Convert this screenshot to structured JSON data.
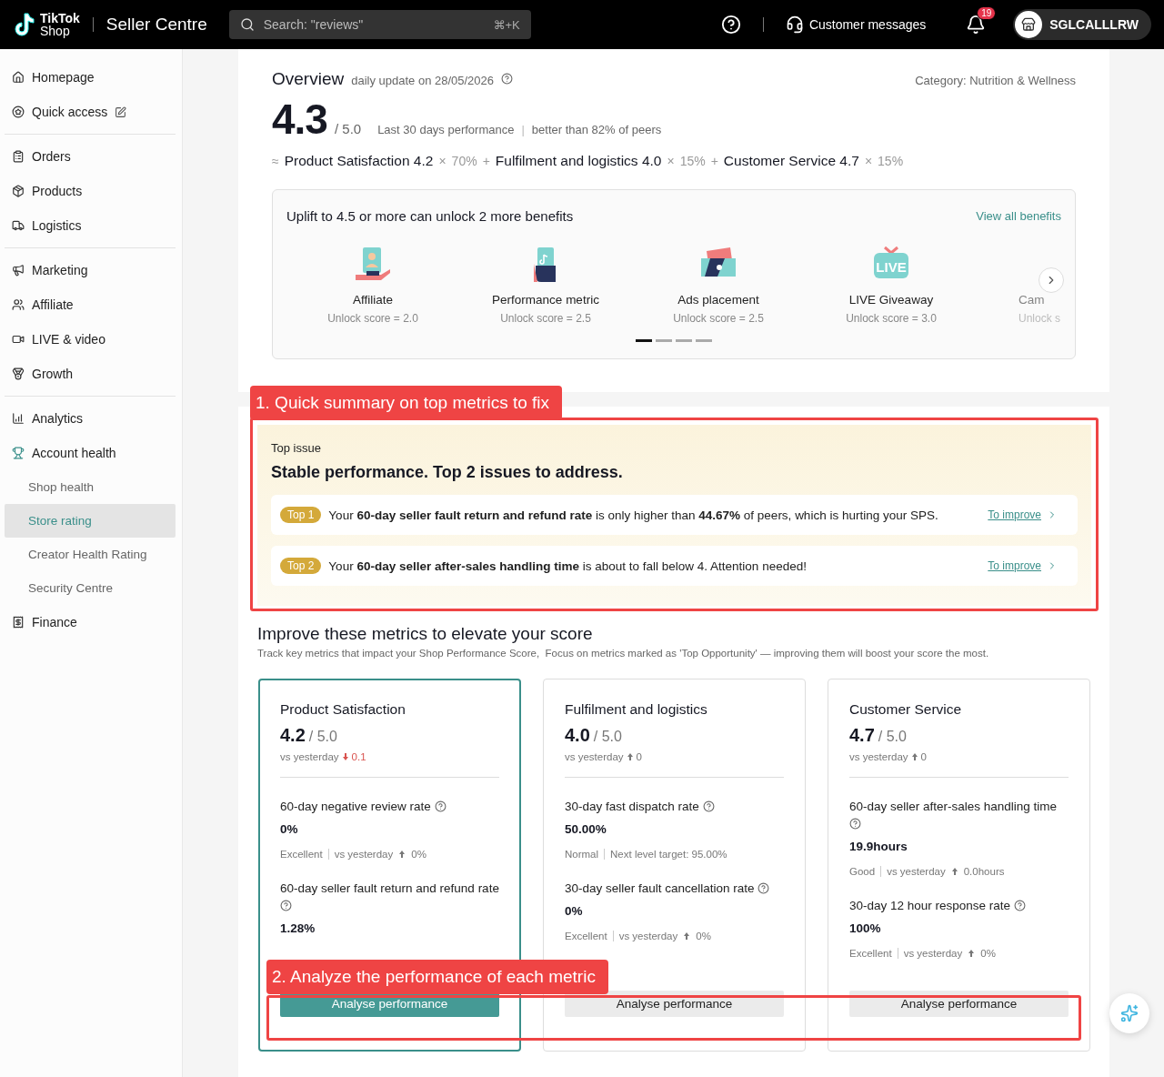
{
  "header": {
    "logo_text": [
      "TikTok",
      "Shop"
    ],
    "app_title": "Seller Centre",
    "search": {
      "placeholder": "Search: \"reviews\"",
      "shortcut": "⌘+K"
    },
    "messages_label": "Customer messages",
    "notifications_count": "19",
    "account_name": "SGLCALLLRW"
  },
  "sidebar": {
    "groups": [
      {
        "items": [
          {
            "label": "Homepage",
            "selected": false
          },
          {
            "label": "Quick access",
            "selected": false
          }
        ]
      },
      {
        "items": [
          {
            "label": "Orders",
            "selected": false
          },
          {
            "label": "Products",
            "selected": false
          },
          {
            "label": "Logistics",
            "selected": false
          }
        ]
      },
      {
        "items": [
          {
            "label": "Marketing",
            "selected": false
          },
          {
            "label": "Affiliate",
            "selected": false
          },
          {
            "label": "LIVE & video",
            "selected": false
          },
          {
            "label": "Growth",
            "selected": false
          }
        ]
      },
      {
        "items": [
          {
            "label": "Analytics",
            "selected": false
          },
          {
            "label": "Account health",
            "selected": false,
            "children": [
              {
                "label": "Shop health",
                "selected": false
              },
              {
                "label": "Store rating",
                "selected": true
              },
              {
                "label": "Creator Health Rating",
                "selected": false
              },
              {
                "label": "Security Centre",
                "selected": false
              }
            ]
          },
          {
            "label": "Finance",
            "selected": false
          }
        ]
      }
    ]
  },
  "overview": {
    "title": "Overview",
    "update_note": "daily update on 28/05/2026",
    "category": "Category: Nutrition & Wellness",
    "score": "4.3",
    "score_max": "/ 5.0",
    "period": "Last 30 days performance",
    "separator": "|",
    "peers": "better than 82% of peers",
    "formula": [
      {
        "kind": "approx",
        "text": "≈"
      },
      {
        "kind": "term",
        "text": "Product Satisfaction 4.2"
      },
      {
        "kind": "times",
        "text": "×"
      },
      {
        "kind": "weight",
        "text": "70%"
      },
      {
        "kind": "plus",
        "text": "+"
      },
      {
        "kind": "term",
        "text": "Fulfilment and logistics 4.0"
      },
      {
        "kind": "times",
        "text": "×"
      },
      {
        "kind": "weight",
        "text": "15%"
      },
      {
        "kind": "plus",
        "text": "+"
      },
      {
        "kind": "term",
        "text": "Customer Service 4.7"
      },
      {
        "kind": "times",
        "text": "×"
      },
      {
        "kind": "weight",
        "text": "15%"
      }
    ]
  },
  "benefits": {
    "title": "Uplift to 4.5 or more can unlock 2 more benefits",
    "link": "View all benefits",
    "items": [
      {
        "name": "Affiliate",
        "unlock": "Unlock score = 2.0",
        "faded": false
      },
      {
        "name": "Performance metric",
        "unlock": "Unlock score = 2.5",
        "faded": false
      },
      {
        "name": "Ads placement",
        "unlock": "Unlock score = 2.5",
        "faded": false
      },
      {
        "name": "LIVE Giveaway",
        "unlock": "Unlock score = 3.0",
        "faded": false,
        "badge": "LIVE"
      },
      {
        "name": "Cam",
        "unlock": "Unlock s",
        "faded": true
      }
    ],
    "pages": [
      {
        "selected": true
      },
      {
        "selected": false
      },
      {
        "selected": false
      },
      {
        "selected": false
      }
    ]
  },
  "annotations": [
    {
      "text": "1. Quick summary on top metrics to fix"
    },
    {
      "text": "2. Analyze the performance of each metric"
    }
  ],
  "top_issue": {
    "label": "Top issue",
    "headline": "Stable performance. Top 2 issues to address.",
    "issues": [
      {
        "badge": "Top 1",
        "text": "Your **60-day seller fault return and refund rate** is only higher than **44.67%** of peers, which is hurting your SPS.",
        "link": "To improve"
      },
      {
        "badge": "Top 2",
        "text": "Your **60-day seller after-sales handling time** is about to fall below 4. Attention needed!",
        "link": "To improve"
      }
    ]
  },
  "improve": {
    "title": "Improve these metrics to elevate your score",
    "subtitle": "Track key metrics that impact your Shop Performance Score,  Focus on metrics marked as 'Top Opportunity' — improving them will boost your score the most.",
    "cards": [
      {
        "title": "Product Satisfaction",
        "score": "4.2",
        "max": "/ 5.0",
        "vs": "vs yesterday",
        "declined": true,
        "delta": "0.1",
        "selected": true,
        "button": "Analyse performance",
        "metrics": [
          {
            "name": "60-day negative review rate",
            "value": "0%",
            "status": "Excellent",
            "note": "vs yesterday",
            "change": "0%"
          },
          {
            "name": "60-day seller fault return and refund rate",
            "value": "1.28%"
          }
        ]
      },
      {
        "title": "Fulfilment and logistics",
        "score": "4.0",
        "max": "/ 5.0",
        "vs": "vs yesterday",
        "declined": false,
        "delta": "0",
        "selected": false,
        "button": "Analyse performance",
        "metrics": [
          {
            "name": "30-day fast dispatch rate",
            "value": "50.00%",
            "status": "Normal",
            "note": "Next level target: 95.00%"
          },
          {
            "name": "30-day seller fault cancellation rate",
            "value": "0%",
            "status": "Excellent",
            "note": "vs yesterday",
            "change": "0%"
          }
        ]
      },
      {
        "title": "Customer Service",
        "score": "4.7",
        "max": "/ 5.0",
        "vs": "vs yesterday",
        "declined": false,
        "delta": "0",
        "selected": false,
        "button": "Analyse performance",
        "metrics": [
          {
            "name": "60-day seller after-sales handling time",
            "value": "19.9hours",
            "status": "Good",
            "note": "vs yesterday",
            "change": "0.0hours"
          },
          {
            "name": "30-day 12 hour response rate",
            "value": "100%",
            "status": "Excellent",
            "note": "vs yesterday",
            "change": "0%"
          }
        ]
      }
    ]
  }
}
